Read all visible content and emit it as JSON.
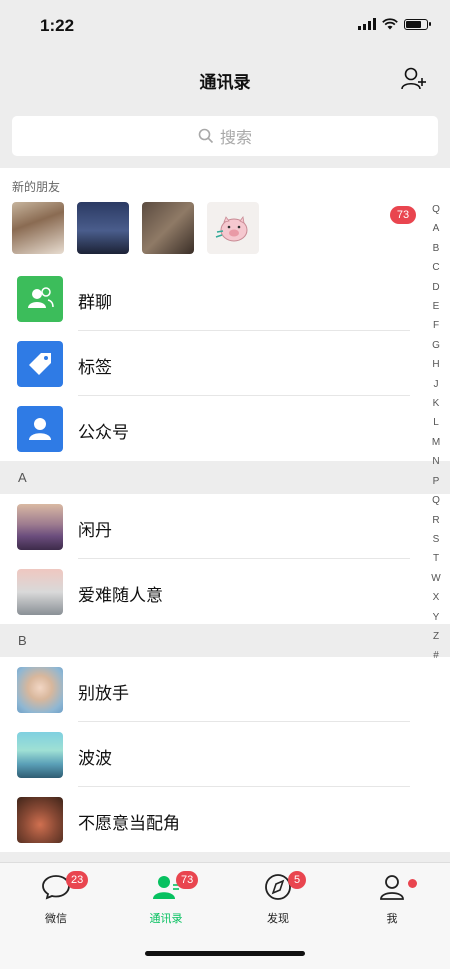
{
  "status_bar": {
    "time": "1:22"
  },
  "nav": {
    "title": "通讯录",
    "add_icon": "add-contact-icon"
  },
  "search": {
    "placeholder": "搜索",
    "icon": "search-icon"
  },
  "new_friends": {
    "label": "新的朋友",
    "badge": "73"
  },
  "features": [
    {
      "label": "群聊",
      "icon": "group-chat-icon",
      "color": "#3cbd5b"
    },
    {
      "label": "标签",
      "icon": "tag-icon",
      "color": "#2f7be5"
    },
    {
      "label": "公众号",
      "icon": "official-account-icon",
      "color": "#2f7be5"
    }
  ],
  "sections": [
    {
      "letter": "A",
      "contacts": [
        "闲丹",
        "爱难随人意"
      ]
    },
    {
      "letter": "B",
      "contacts": [
        "别放手",
        "波波",
        "不愿意当配角"
      ]
    }
  ],
  "index_letters": [
    "Q",
    "A",
    "B",
    "C",
    "D",
    "E",
    "F",
    "G",
    "H",
    "J",
    "K",
    "L",
    "M",
    "N",
    "P",
    "Q",
    "R",
    "S",
    "T",
    "W",
    "X",
    "Y",
    "Z",
    "#"
  ],
  "tabs": [
    {
      "label": "微信",
      "badge": "23",
      "icon": "chat-bubble-icon"
    },
    {
      "label": "通讯录",
      "badge": "73",
      "icon": "contacts-icon"
    },
    {
      "label": "发现",
      "badge": "5",
      "icon": "compass-icon"
    },
    {
      "label": "我",
      "badge": "",
      "icon": "me-icon"
    }
  ],
  "colors": {
    "accent": "#07c160",
    "badge": "#e9454f",
    "feature_green": "#3cbd5b",
    "feature_blue": "#2f7be5"
  }
}
